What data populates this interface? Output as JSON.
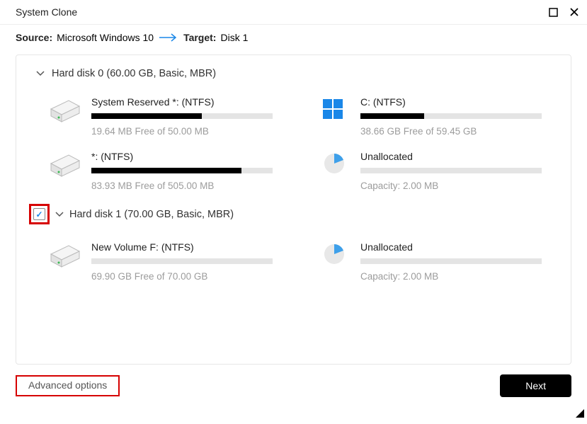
{
  "window": {
    "title": "System Clone"
  },
  "header": {
    "source_label": "Source:",
    "source_value": "Microsoft Windows 10",
    "target_label": "Target:",
    "target_value": "Disk 1"
  },
  "disks": [
    {
      "label": "Hard disk 0 (60.00 GB, Basic, MBR)",
      "checked": false,
      "partitions": [
        {
          "name": "System Reserved *: (NTFS)",
          "free_text": "19.64 MB Free of 50.00 MB",
          "fill_pct": 61,
          "icon": "disk"
        },
        {
          "name": "C: (NTFS)",
          "free_text": "38.66 GB Free of 59.45 GB",
          "fill_pct": 35,
          "icon": "windows"
        },
        {
          "name": "*: (NTFS)",
          "free_text": "83.93 MB Free of 505.00 MB",
          "fill_pct": 83,
          "icon": "disk"
        },
        {
          "name": "Unallocated",
          "free_text": "Capacity: 2.00 MB",
          "fill_pct": 0,
          "icon": "pie"
        }
      ]
    },
    {
      "label": "Hard disk 1 (70.00 GB, Basic, MBR)",
      "checked": true,
      "partitions": [
        {
          "name": "New Volume F: (NTFS)",
          "free_text": "69.90 GB Free of 70.00 GB",
          "fill_pct": 0,
          "icon": "disk"
        },
        {
          "name": "Unallocated",
          "free_text": "Capacity: 2.00 MB",
          "fill_pct": 0,
          "icon": "pie"
        }
      ]
    }
  ],
  "footer": {
    "advanced_label": "Advanced options",
    "next_label": "Next"
  }
}
